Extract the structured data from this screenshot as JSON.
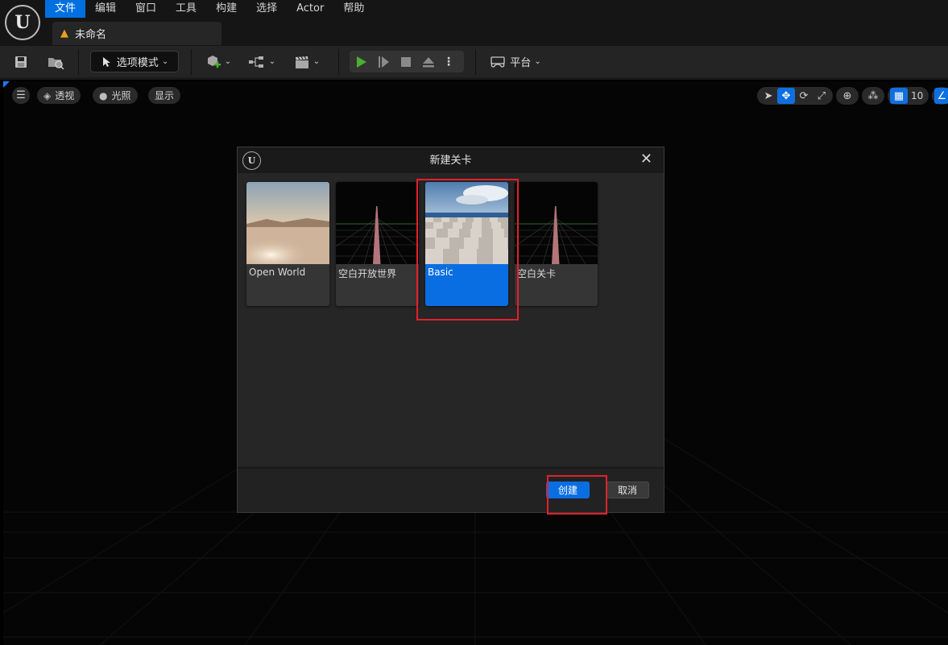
{
  "menubar": {
    "items": [
      "文件",
      "编辑",
      "窗口",
      "工具",
      "构建",
      "选择",
      "Actor",
      "帮助"
    ],
    "active_index": 0
  },
  "document_tab": {
    "label": "未命名"
  },
  "toolbar": {
    "mode_label": "选项模式",
    "platform_label": "平台"
  },
  "viewport": {
    "perspective_label": "透视",
    "lighting_label": "光照",
    "show_label": "显示",
    "grid_snap_value": "10"
  },
  "dialog": {
    "title": "新建关卡",
    "templates": [
      {
        "name": "Open World",
        "selected": false
      },
      {
        "name": "空白开放世界",
        "selected": false
      },
      {
        "name": "Basic",
        "selected": true
      },
      {
        "name": "空白关卡",
        "selected": false
      }
    ],
    "create_label": "创建",
    "cancel_label": "取消"
  },
  "colors": {
    "accent": "#0a6ee3",
    "highlight_box": "#e3202a",
    "play_green": "#4cae2f",
    "warning": "#e8a21a"
  }
}
